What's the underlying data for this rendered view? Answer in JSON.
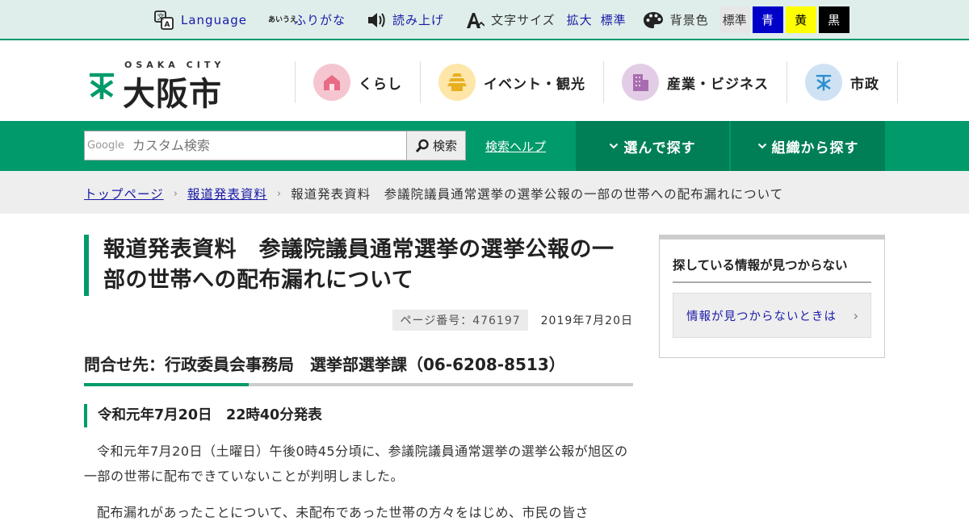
{
  "utility": {
    "language": "Language",
    "furigana_icon": "あいうえ",
    "furigana": "ふりがな",
    "read_aloud": "読み上げ",
    "font_size": "文字サイズ",
    "font_large": "拡大",
    "font_standard": "標準",
    "background": "背景色",
    "bg_options": [
      "標準",
      "青",
      "黄",
      "黒"
    ]
  },
  "logo": {
    "english": "OSAKA CITY",
    "japanese": "大阪市"
  },
  "global_nav": [
    {
      "label": "くらし",
      "icon": "house-icon",
      "color": "#f5c6cf"
    },
    {
      "label": "イベント・観光",
      "icon": "castle-icon",
      "color": "#fde6a8"
    },
    {
      "label": "産業・ビジネス",
      "icon": "building-icon",
      "color": "#e3cde6"
    },
    {
      "label": "市政",
      "icon": "city-mark-icon",
      "color": "#cfe2f3"
    }
  ],
  "search": {
    "google_label": "Google",
    "placeholder": "カスタム検索",
    "button": "検索",
    "help": "検索ヘルプ",
    "tab_choose": "選んで探す",
    "tab_org": "組織から探す"
  },
  "breadcrumb": {
    "top": "トップページ",
    "press": "報道発表資料",
    "current": "報道発表資料　参議院議員通常選挙の選挙公報の一部の世帯への配布漏れについて"
  },
  "article": {
    "title": "報道発表資料　参議院議員通常選挙の選挙公報の一部の世帯への配布漏れについて",
    "page_number": "ページ番号：476197",
    "date": "2019年7月20日",
    "contact": "問合せ先：行政委員会事務局　選挙部選挙課（06-6208-8513）",
    "announce": "令和元年7月20日　22時40分発表",
    "para1": "令和元年7月20日（土曜日）午後0時45分頃に、参議院議員通常選挙の選挙公報が旭区の一部の世帯に配布できていないことが判明しました。",
    "para2": "配布漏れがあったことについて、未配布であった世帯の方々をはじめ、市民の皆さ"
  },
  "sidebar": {
    "title": "探している情報が見つからない",
    "link": "情報が見つからないときは"
  },
  "colors": {
    "accent": "#009a6b",
    "accent_dark": "#007f57",
    "link": "#1a1aa8"
  }
}
